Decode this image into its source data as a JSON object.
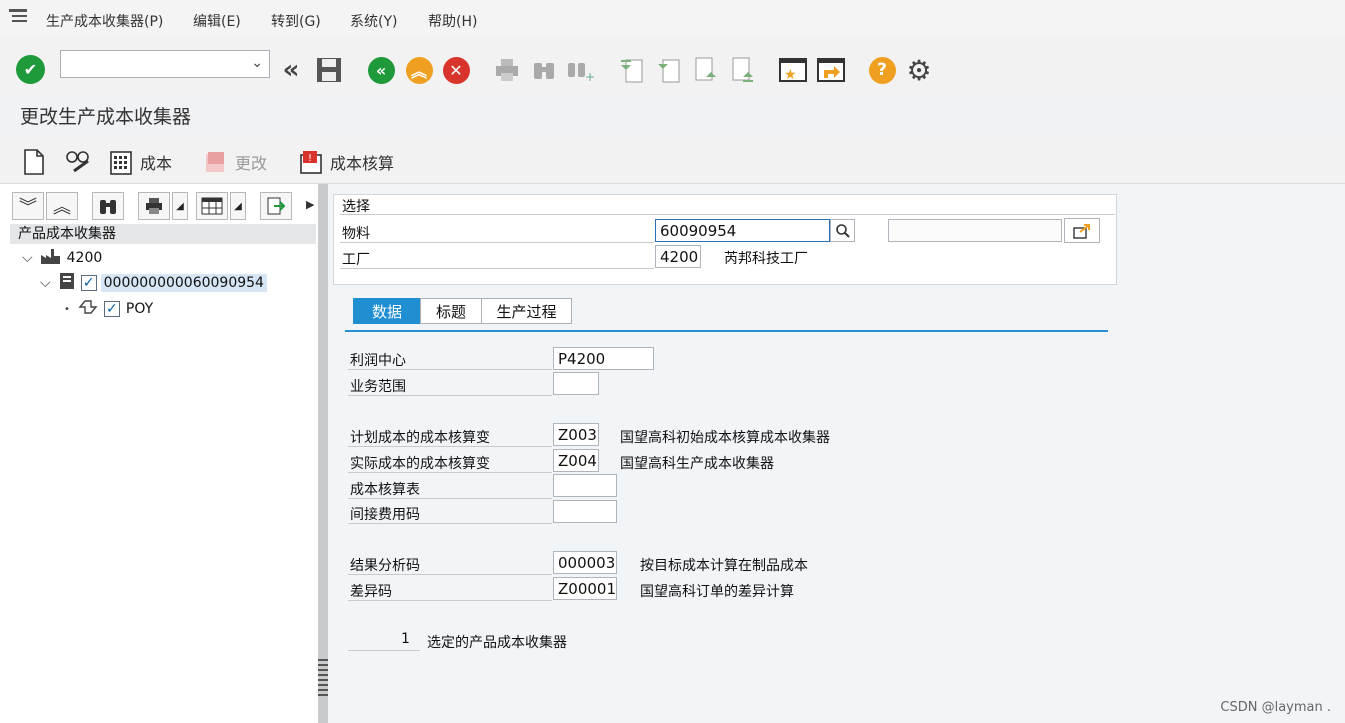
{
  "menu": {
    "items": [
      "生产成本收集器(P)",
      "编辑(E)",
      "转到(G)",
      "系统(Y)",
      "帮助(H)"
    ]
  },
  "toolbar": {
    "command_field": {
      "value": "",
      "placeholder": ""
    },
    "icons": [
      "check-icon",
      "dropdown-icon",
      "double-left-icon",
      "save-icon",
      "back-icon",
      "exit-icon",
      "cancel-icon",
      "print-icon",
      "find-icon",
      "find-next-icon",
      "first-page-icon",
      "prev-page-icon",
      "next-page-icon",
      "last-page-icon",
      "new-window-icon",
      "shortcut-icon",
      "help-icon",
      "settings-icon"
    ]
  },
  "page_title": "更改生产成本收集器",
  "appbar": {
    "cost_label": "成本",
    "change_label": "更改",
    "costing_label": "成本核算"
  },
  "left": {
    "tree_header": "产品成本收集器",
    "nodes": [
      {
        "label": "4200"
      },
      {
        "label": "000000000060090954"
      },
      {
        "label": "POY"
      }
    ]
  },
  "selection": {
    "group_title": "选择",
    "material_label": "物料",
    "material_value": "60090954",
    "material_text": "",
    "plant_label": "工厂",
    "plant_value": "4200",
    "plant_name": "芮邦科技工厂"
  },
  "tabs": [
    "数据",
    "标题",
    "生产过程"
  ],
  "data": {
    "profit_center_label": "利润中心",
    "profit_center_value": "P4200",
    "business_area_label": "业务范围",
    "business_area_value": "",
    "plan_variant_label": "计划成本的成本核算变",
    "plan_variant_value": "Z003",
    "plan_variant_desc": "国望高科初始成本核算成本收集器",
    "actual_variant_label": "实际成本的成本核算变",
    "actual_variant_value": "Z004",
    "actual_variant_desc": "国望高科生产成本收集器",
    "costing_sheet_label": "成本核算表",
    "costing_sheet_value": "",
    "overhead_label": "间接费用码",
    "overhead_value": "",
    "ra_key_label": "结果分析码",
    "ra_key_value": "000003",
    "ra_key_desc": "按目标成本计算在制品成本",
    "variance_label": "差异码",
    "variance_value": "Z00001",
    "variance_desc": "国望高科订单的差异计算",
    "count_value": "1",
    "count_label": "选定的产品成本收集器"
  },
  "watermark": "CSDN @layman ."
}
